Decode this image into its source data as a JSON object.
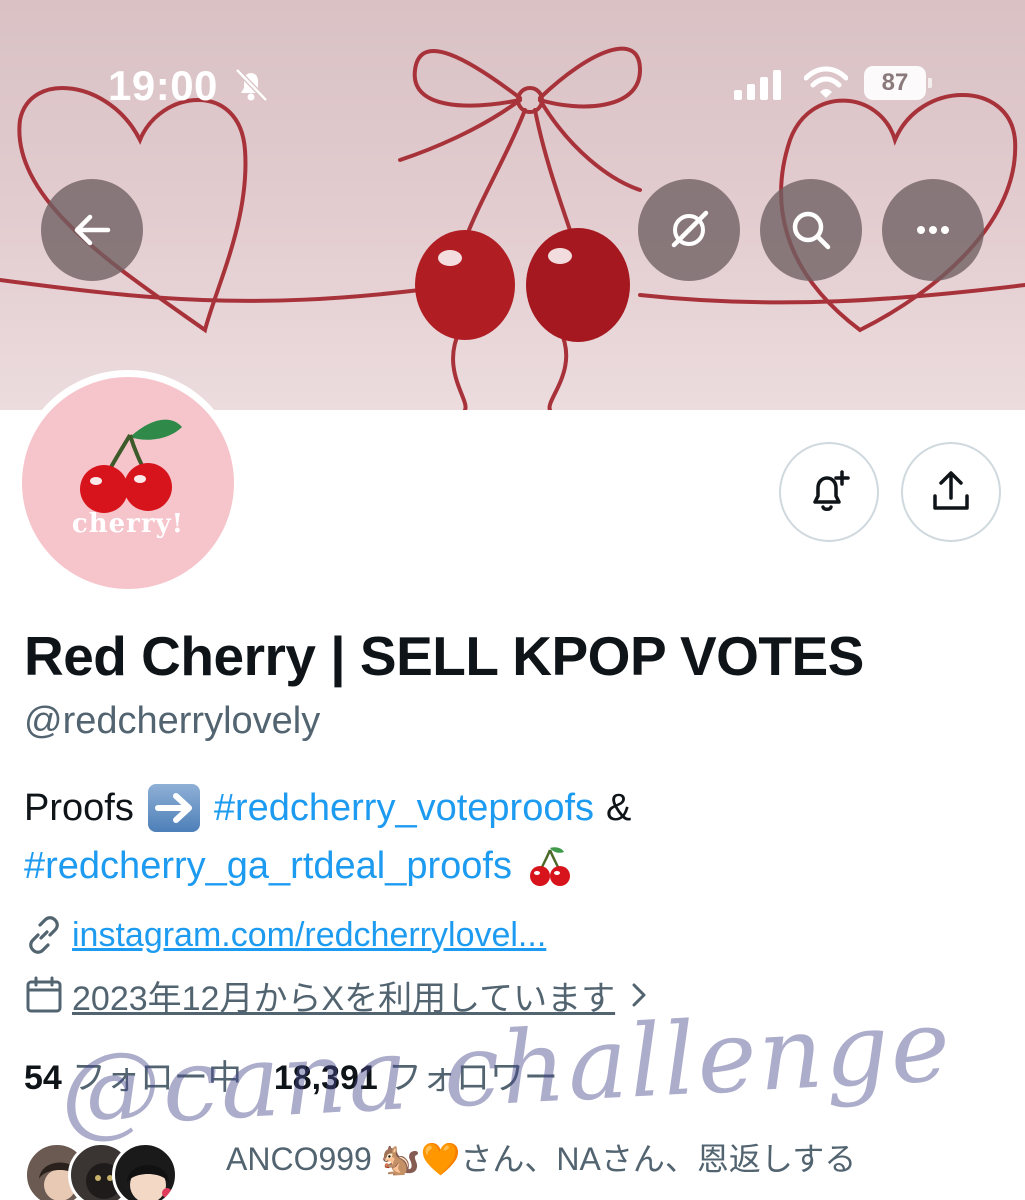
{
  "status_bar": {
    "time": "19:00",
    "battery_level": "87",
    "icons": [
      "bell-slash-icon",
      "cellular-signal-icon",
      "wifi-icon",
      "battery-icon"
    ]
  },
  "header": {
    "icons": [
      "back-arrow-icon",
      "grok-icon",
      "search-icon",
      "more-icon"
    ]
  },
  "profile": {
    "avatar_text": "cherry!",
    "display_name": "Red Cherry | SELL KPOP VOTES",
    "handle": "@redcherrylovely",
    "bio": {
      "proofs_label": "Proofs",
      "hashtag_1": "#redcherry_voteproofs",
      "ampersand": "&",
      "hashtag_2": "#redcherry_ga_rtdeal_proofs"
    },
    "link": "instagram.com/redcherrylovel...",
    "joined": "2023年12月からXを利用しています",
    "following_count": "54",
    "following_label": "フォロー中",
    "followers_count": "18,391",
    "followers_label": "フォロワー",
    "followed_by": "ANCO999 🐿️🧡さん、NAさん、恩返しする"
  },
  "watermark": "@cana challenge",
  "colors": {
    "link": "#1d9bf0",
    "secondary_text": "#536471",
    "banner_bg": "#e3cdd0",
    "cherry_red": "#b01e24",
    "avatar_bg": "#f6c5cc"
  }
}
